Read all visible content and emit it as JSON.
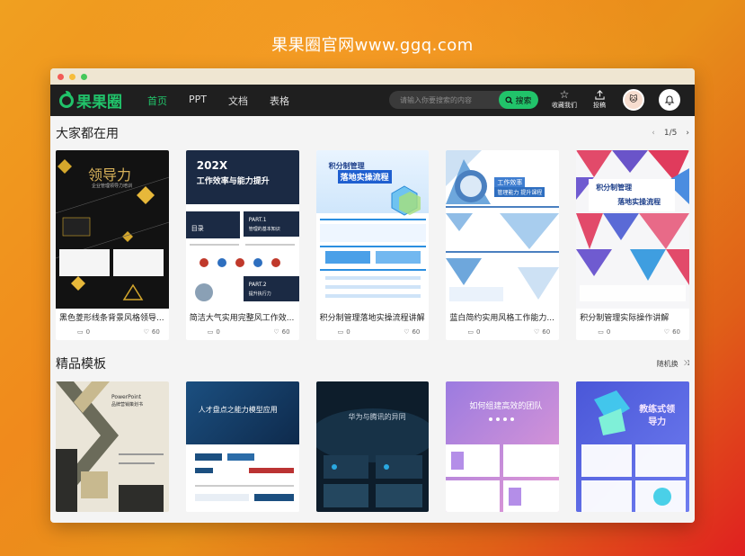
{
  "site_title": "果果圈官网www.ggq.com",
  "brand": {
    "name": "果果圈",
    "color": "#21c36a"
  },
  "nav": {
    "items": [
      "首页",
      "PPT",
      "文档",
      "表格"
    ],
    "active_index": 0
  },
  "search": {
    "placeholder": "请输入你要搜索的内容",
    "button_label": "搜索"
  },
  "tools": {
    "favorite_label": "收藏我们",
    "submit_label": "投稿"
  },
  "section1": {
    "title": "大家都在用",
    "page_indicator": "1/5",
    "cards": [
      {
        "title": "黑色菱形线条背景风格领导...",
        "comments": "0",
        "likes": "60"
      },
      {
        "title": "简洁大气实用完整风工作效...",
        "comments": "0",
        "likes": "60"
      },
      {
        "title": "积分制管理落地实操流程讲解",
        "comments": "0",
        "likes": "60"
      },
      {
        "title": "蓝白简约实用风格工作能力...",
        "comments": "0",
        "likes": "60"
      },
      {
        "title": "积分制管理实际操作讲解",
        "comments": "0",
        "likes": "60"
      }
    ]
  },
  "section2": {
    "title": "精品模板",
    "random_label": "随机换"
  },
  "thumbs": {
    "t1": {
      "headline": "领导力",
      "subtitle": "企业管理领导力培训"
    },
    "t2": {
      "headline_1": "202X",
      "headline_2": "工作效率与能力提升",
      "part1": "PART.1",
      "part1_sub": "管理的基本知识",
      "part2": "PART.2",
      "part2_sub": "提升执行力",
      "toc": "目录"
    },
    "t3": {
      "headline_1": "积分制管理",
      "headline_2": "落地实操流程"
    },
    "t4": {
      "headline_1": "工作效率",
      "headline_2": "管理能力 提升课程"
    },
    "t5": {
      "headline_1": "积分制管理",
      "headline_2": "落地实操流程"
    },
    "m1": {
      "headline": "PowerPoint",
      "subtitle": "品牌营销策划书"
    },
    "m2": {
      "headline": "人才盘点之能力模型应用"
    },
    "m3": {
      "headline": "华为与腾讯的异同"
    },
    "m4": {
      "headline": "如何组建高效的团队"
    },
    "m5": {
      "headline_1": "教练式领",
      "headline_2": "导力"
    }
  },
  "colors": {
    "accent": "#21c36a",
    "navbar": "#1f1f1f"
  }
}
